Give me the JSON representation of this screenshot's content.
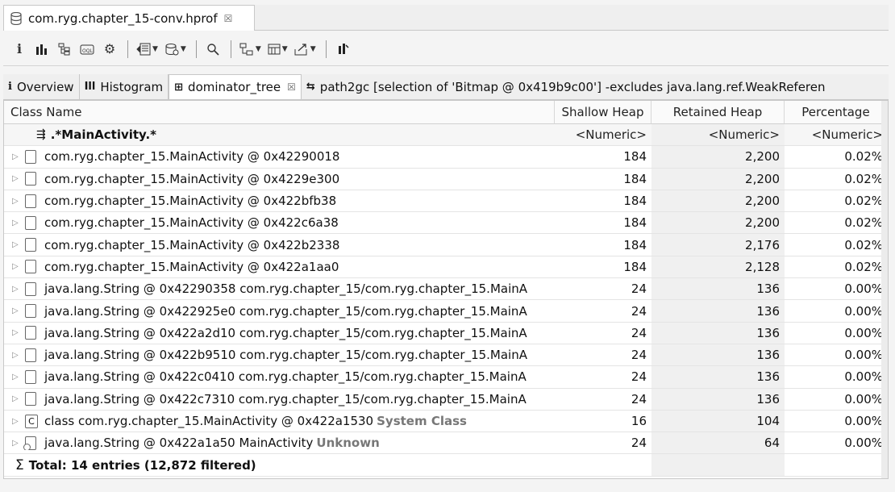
{
  "editor_tab": {
    "title": "com.ryg.chapter_15-conv.hprof",
    "close": "☒"
  },
  "toolbar": {
    "items": [
      "i",
      "histogram-icon",
      "dominator-icon",
      "oql-icon",
      "gear-icon",
      "query-icon",
      "heapdump-icon",
      "search-icon",
      "group-icon",
      "calc-icon",
      "export-icon",
      "pin-icon"
    ]
  },
  "view_tabs": [
    {
      "icon": "i",
      "label": "Overview"
    },
    {
      "icon": "Ill",
      "label": "Histogram"
    },
    {
      "icon": "⊞",
      "label": "dominator_tree",
      "close": "☒"
    },
    {
      "icon": "⇆",
      "label": "path2gc [selection of 'Bitmap @ 0x419b9c00'] -excludes java.lang.ref.WeakReferen"
    }
  ],
  "table": {
    "headers": {
      "name": "Class Name",
      "shallow": "Shallow Heap",
      "retained": "Retained Heap",
      "pct": "Percentage"
    },
    "filter": {
      "name": ".*MainActivity.*",
      "shallow": "<Numeric>",
      "retained": "<Numeric>",
      "pct": "<Numeric>"
    },
    "rows": [
      {
        "icon": "object",
        "name": "com.ryg.chapter_15.MainActivity @ 0x42290018",
        "suffix": "",
        "shallow": "184",
        "retained": "2,200",
        "pct": "0.02%"
      },
      {
        "icon": "object",
        "name": "com.ryg.chapter_15.MainActivity @ 0x4229e300",
        "suffix": "",
        "shallow": "184",
        "retained": "2,200",
        "pct": "0.02%"
      },
      {
        "icon": "object",
        "name": "com.ryg.chapter_15.MainActivity @ 0x422bfb38",
        "suffix": "",
        "shallow": "184",
        "retained": "2,200",
        "pct": "0.02%"
      },
      {
        "icon": "object",
        "name": "com.ryg.chapter_15.MainActivity @ 0x422c6a38",
        "suffix": "",
        "shallow": "184",
        "retained": "2,200",
        "pct": "0.02%"
      },
      {
        "icon": "object",
        "name": "com.ryg.chapter_15.MainActivity @ 0x422b2338",
        "suffix": "",
        "shallow": "184",
        "retained": "2,176",
        "pct": "0.02%"
      },
      {
        "icon": "object",
        "name": "com.ryg.chapter_15.MainActivity @ 0x422a1aa0",
        "suffix": "",
        "shallow": "184",
        "retained": "2,128",
        "pct": "0.02%"
      },
      {
        "icon": "object",
        "name": "java.lang.String @ 0x42290358  com.ryg.chapter_15/com.ryg.chapter_15.MainA",
        "suffix": "",
        "shallow": "24",
        "retained": "136",
        "pct": "0.00%"
      },
      {
        "icon": "object",
        "name": "java.lang.String @ 0x422925e0  com.ryg.chapter_15/com.ryg.chapter_15.MainA",
        "suffix": "",
        "shallow": "24",
        "retained": "136",
        "pct": "0.00%"
      },
      {
        "icon": "object",
        "name": "java.lang.String @ 0x422a2d10  com.ryg.chapter_15/com.ryg.chapter_15.MainA",
        "suffix": "",
        "shallow": "24",
        "retained": "136",
        "pct": "0.00%"
      },
      {
        "icon": "object",
        "name": "java.lang.String @ 0x422b9510  com.ryg.chapter_15/com.ryg.chapter_15.MainA",
        "suffix": "",
        "shallow": "24",
        "retained": "136",
        "pct": "0.00%"
      },
      {
        "icon": "object",
        "name": "java.lang.String @ 0x422c0410  com.ryg.chapter_15/com.ryg.chapter_15.MainA",
        "suffix": "",
        "shallow": "24",
        "retained": "136",
        "pct": "0.00%"
      },
      {
        "icon": "object",
        "name": "java.lang.String @ 0x422c7310  com.ryg.chapter_15/com.ryg.chapter_15.MainA",
        "suffix": "",
        "shallow": "24",
        "retained": "136",
        "pct": "0.00%"
      },
      {
        "icon": "class",
        "name": "class com.ryg.chapter_15.MainActivity @ 0x422a1530",
        "suffix": "System Class",
        "shallow": "16",
        "retained": "104",
        "pct": "0.00%"
      },
      {
        "icon": "string-root",
        "name": "java.lang.String @ 0x422a1a50  MainActivity",
        "suffix": "Unknown",
        "shallow": "24",
        "retained": "64",
        "pct": "0.00%"
      }
    ],
    "total": {
      "sigma": "Σ",
      "label": "Total: 14 entries (12,872 filtered)"
    }
  }
}
